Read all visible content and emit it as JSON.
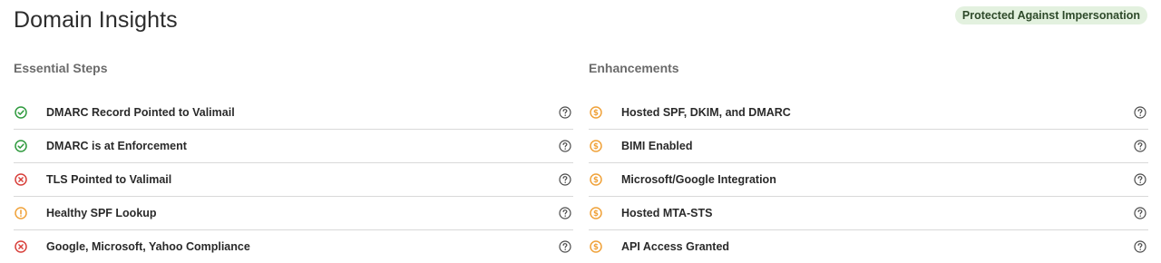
{
  "header": {
    "title": "Domain Insights",
    "badge": "Protected Against Impersonation"
  },
  "colors": {
    "success": "#2f9a3e",
    "error": "#d8403b",
    "warning": "#f0a23a",
    "badge_bg": "#e3f1df",
    "divider": "#d9d9d9"
  },
  "essential": {
    "heading": "Essential Steps",
    "items": [
      {
        "label": "DMARC Record Pointed to Valimail",
        "status": "check-circle-icon"
      },
      {
        "label": "DMARC is at Enforcement",
        "status": "check-circle-icon"
      },
      {
        "label": "TLS Pointed to Valimail",
        "status": "x-circle-icon"
      },
      {
        "label": "Healthy SPF Lookup",
        "status": "warning-circle-icon"
      },
      {
        "label": "Google, Microsoft, Yahoo Compliance",
        "status": "x-circle-icon"
      }
    ]
  },
  "enhancements": {
    "heading": "Enhancements",
    "items": [
      {
        "label": "Hosted SPF, DKIM, and DMARC",
        "status": "dollar-circle-icon"
      },
      {
        "label": "BIMI Enabled",
        "status": "dollar-circle-icon"
      },
      {
        "label": "Microsoft/Google Integration",
        "status": "dollar-circle-icon"
      },
      {
        "label": "Hosted MTA-STS",
        "status": "dollar-circle-icon"
      },
      {
        "label": "API Access Granted",
        "status": "dollar-circle-icon"
      }
    ]
  }
}
